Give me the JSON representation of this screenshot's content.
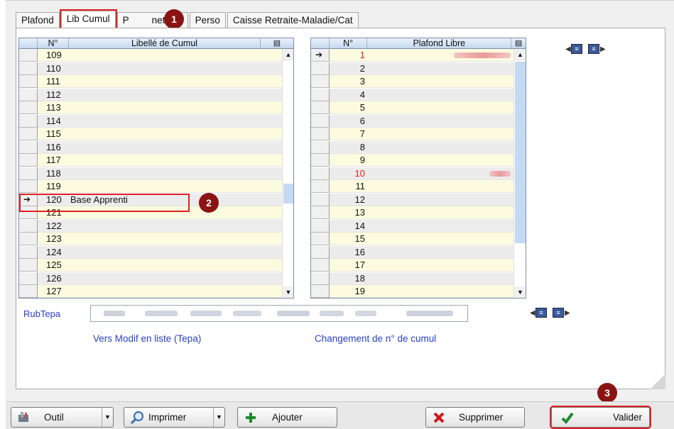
{
  "tabs": [
    "Plafond",
    "Lib Cumul",
    "Paramètres",
    "Perso",
    "Caisse Retraite-Maladie/Cat"
  ],
  "tab_visible_text": [
    "Plafond",
    "Lib Cumul",
    "P",
    "netres",
    "Perso",
    "Caisse Retraite-Maladie/Cat"
  ],
  "left_grid": {
    "col_num": "N°",
    "col_label": "Libellé de Cumul",
    "rows": [
      {
        "n": "109",
        "label": ""
      },
      {
        "n": "110",
        "label": ""
      },
      {
        "n": "111",
        "label": ""
      },
      {
        "n": "112",
        "label": ""
      },
      {
        "n": "113",
        "label": ""
      },
      {
        "n": "114",
        "label": ""
      },
      {
        "n": "115",
        "label": ""
      },
      {
        "n": "116",
        "label": ""
      },
      {
        "n": "117",
        "label": ""
      },
      {
        "n": "118",
        "label": ""
      },
      {
        "n": "119",
        "label": ""
      },
      {
        "n": "120",
        "label": "Base Apprenti"
      },
      {
        "n": "121",
        "label": ""
      },
      {
        "n": "122",
        "label": ""
      },
      {
        "n": "123",
        "label": ""
      },
      {
        "n": "124",
        "label": ""
      },
      {
        "n": "125",
        "label": ""
      },
      {
        "n": "126",
        "label": ""
      },
      {
        "n": "127",
        "label": ""
      }
    ],
    "current_row_index": 11
  },
  "right_grid": {
    "col_num": "N°",
    "col_label": "Plafond Libre",
    "rows": [
      "1",
      "2",
      "3",
      "4",
      "5",
      "6",
      "7",
      "8",
      "9",
      "10",
      "11",
      "12",
      "13",
      "14",
      "15",
      "16",
      "17",
      "18",
      "19"
    ],
    "red_rows": [
      0,
      9
    ],
    "blurred_rows": [
      0,
      9
    ],
    "current_row_index": 0
  },
  "rubtepa_label": "RubTepa",
  "links": {
    "modif": "Vers Modif en liste (Tepa)",
    "change": "Changement de n° de cumul"
  },
  "callouts": [
    "1",
    "2",
    "3"
  ],
  "buttons": {
    "outil": "Outil",
    "imprimer": "Imprimer",
    "ajouter": "Ajouter",
    "supprimer": "Supprimer",
    "valider": "Valider"
  },
  "colors": {
    "highlight": "#e02020",
    "callout": "#8a1414",
    "link": "#2840c8",
    "row_odd": "#fdfbdf",
    "row_even": "#ececec"
  }
}
